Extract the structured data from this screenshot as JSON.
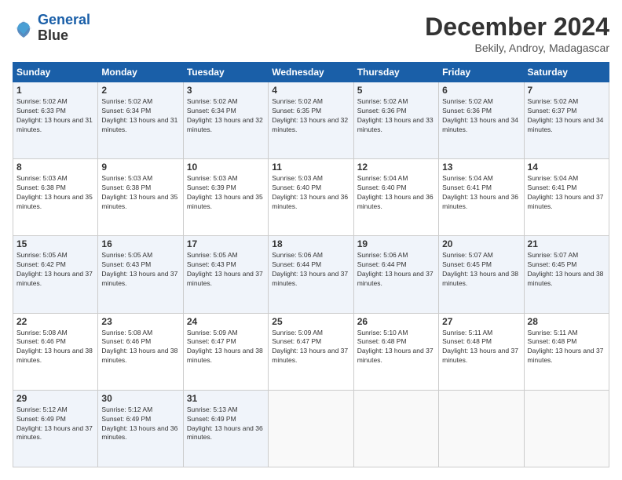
{
  "logo": {
    "line1": "General",
    "line2": "Blue"
  },
  "title": "December 2024",
  "location": "Bekily, Androy, Madagascar",
  "days_of_week": [
    "Sunday",
    "Monday",
    "Tuesday",
    "Wednesday",
    "Thursday",
    "Friday",
    "Saturday"
  ],
  "weeks": [
    [
      {
        "day": "1",
        "sunrise": "5:02 AM",
        "sunset": "6:33 PM",
        "daylight": "13 hours and 31 minutes."
      },
      {
        "day": "2",
        "sunrise": "5:02 AM",
        "sunset": "6:34 PM",
        "daylight": "13 hours and 31 minutes."
      },
      {
        "day": "3",
        "sunrise": "5:02 AM",
        "sunset": "6:34 PM",
        "daylight": "13 hours and 32 minutes."
      },
      {
        "day": "4",
        "sunrise": "5:02 AM",
        "sunset": "6:35 PM",
        "daylight": "13 hours and 32 minutes."
      },
      {
        "day": "5",
        "sunrise": "5:02 AM",
        "sunset": "6:36 PM",
        "daylight": "13 hours and 33 minutes."
      },
      {
        "day": "6",
        "sunrise": "5:02 AM",
        "sunset": "6:36 PM",
        "daylight": "13 hours and 34 minutes."
      },
      {
        "day": "7",
        "sunrise": "5:02 AM",
        "sunset": "6:37 PM",
        "daylight": "13 hours and 34 minutes."
      }
    ],
    [
      {
        "day": "8",
        "sunrise": "5:03 AM",
        "sunset": "6:38 PM",
        "daylight": "13 hours and 35 minutes."
      },
      {
        "day": "9",
        "sunrise": "5:03 AM",
        "sunset": "6:38 PM",
        "daylight": "13 hours and 35 minutes."
      },
      {
        "day": "10",
        "sunrise": "5:03 AM",
        "sunset": "6:39 PM",
        "daylight": "13 hours and 35 minutes."
      },
      {
        "day": "11",
        "sunrise": "5:03 AM",
        "sunset": "6:40 PM",
        "daylight": "13 hours and 36 minutes."
      },
      {
        "day": "12",
        "sunrise": "5:04 AM",
        "sunset": "6:40 PM",
        "daylight": "13 hours and 36 minutes."
      },
      {
        "day": "13",
        "sunrise": "5:04 AM",
        "sunset": "6:41 PM",
        "daylight": "13 hours and 36 minutes."
      },
      {
        "day": "14",
        "sunrise": "5:04 AM",
        "sunset": "6:41 PM",
        "daylight": "13 hours and 37 minutes."
      }
    ],
    [
      {
        "day": "15",
        "sunrise": "5:05 AM",
        "sunset": "6:42 PM",
        "daylight": "13 hours and 37 minutes."
      },
      {
        "day": "16",
        "sunrise": "5:05 AM",
        "sunset": "6:43 PM",
        "daylight": "13 hours and 37 minutes."
      },
      {
        "day": "17",
        "sunrise": "5:05 AM",
        "sunset": "6:43 PM",
        "daylight": "13 hours and 37 minutes."
      },
      {
        "day": "18",
        "sunrise": "5:06 AM",
        "sunset": "6:44 PM",
        "daylight": "13 hours and 37 minutes."
      },
      {
        "day": "19",
        "sunrise": "5:06 AM",
        "sunset": "6:44 PM",
        "daylight": "13 hours and 37 minutes."
      },
      {
        "day": "20",
        "sunrise": "5:07 AM",
        "sunset": "6:45 PM",
        "daylight": "13 hours and 38 minutes."
      },
      {
        "day": "21",
        "sunrise": "5:07 AM",
        "sunset": "6:45 PM",
        "daylight": "13 hours and 38 minutes."
      }
    ],
    [
      {
        "day": "22",
        "sunrise": "5:08 AM",
        "sunset": "6:46 PM",
        "daylight": "13 hours and 38 minutes."
      },
      {
        "day": "23",
        "sunrise": "5:08 AM",
        "sunset": "6:46 PM",
        "daylight": "13 hours and 38 minutes."
      },
      {
        "day": "24",
        "sunrise": "5:09 AM",
        "sunset": "6:47 PM",
        "daylight": "13 hours and 38 minutes."
      },
      {
        "day": "25",
        "sunrise": "5:09 AM",
        "sunset": "6:47 PM",
        "daylight": "13 hours and 37 minutes."
      },
      {
        "day": "26",
        "sunrise": "5:10 AM",
        "sunset": "6:48 PM",
        "daylight": "13 hours and 37 minutes."
      },
      {
        "day": "27",
        "sunrise": "5:11 AM",
        "sunset": "6:48 PM",
        "daylight": "13 hours and 37 minutes."
      },
      {
        "day": "28",
        "sunrise": "5:11 AM",
        "sunset": "6:48 PM",
        "daylight": "13 hours and 37 minutes."
      }
    ],
    [
      {
        "day": "29",
        "sunrise": "5:12 AM",
        "sunset": "6:49 PM",
        "daylight": "13 hours and 37 minutes."
      },
      {
        "day": "30",
        "sunrise": "5:12 AM",
        "sunset": "6:49 PM",
        "daylight": "13 hours and 36 minutes."
      },
      {
        "day": "31",
        "sunrise": "5:13 AM",
        "sunset": "6:49 PM",
        "daylight": "13 hours and 36 minutes."
      },
      null,
      null,
      null,
      null
    ]
  ]
}
